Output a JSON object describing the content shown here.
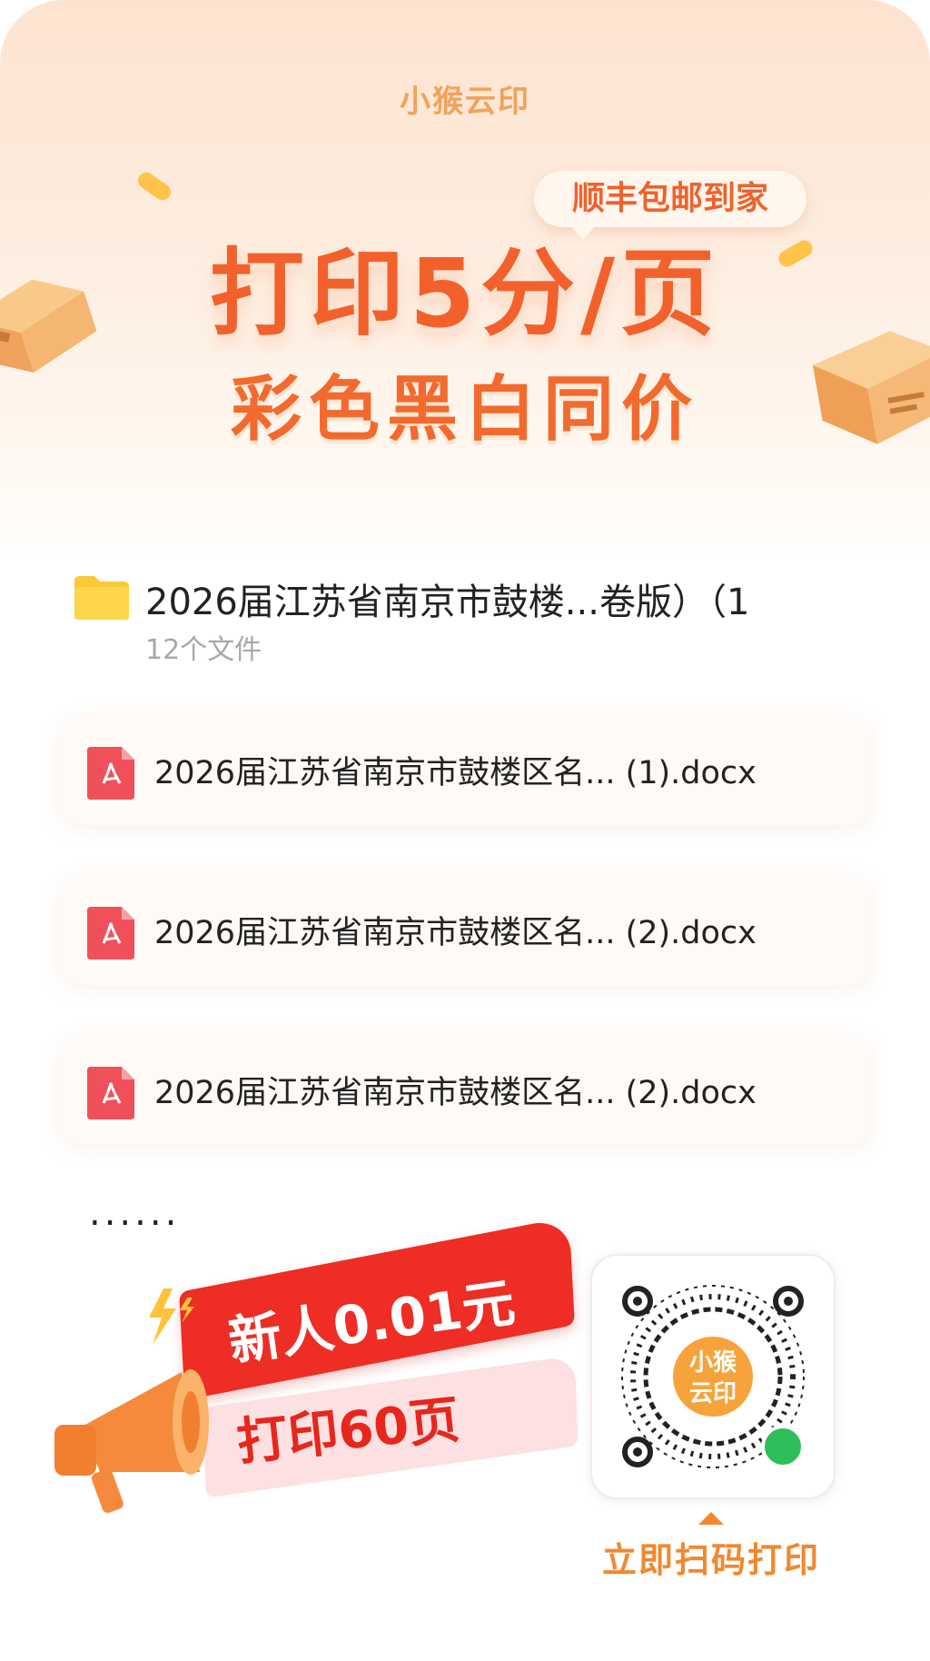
{
  "brand": {
    "name": "小猴云印"
  },
  "banner": {
    "tag": "顺丰包邮到家",
    "headline_line1": "打印5分/页",
    "headline_line2": "彩色黑白同价"
  },
  "folder": {
    "name": "2026届江苏省南京市鼓楼...卷版）（1",
    "count": "12个文件",
    "icon": "folder-icon"
  },
  "files": [
    {
      "name": "2026届江苏省南京市鼓楼区名... (1).docx",
      "icon": "pdf-icon"
    },
    {
      "name": "2026届江苏省南京市鼓楼区名... (2).docx",
      "icon": "pdf-icon"
    },
    {
      "name": "2026届江苏省南京市鼓楼区名... (2).docx",
      "icon": "pdf-icon"
    }
  ],
  "more": "......",
  "promo": {
    "line1": "新人0.01元",
    "line2": "打印60页"
  },
  "qr": {
    "center_text_top": "小猴",
    "center_text_bottom": "云印",
    "caption": "立即扫码打印"
  },
  "colors": {
    "accent": "#f2612c",
    "brand_orange": "#f7a33b",
    "promo_red": "#ee2d24",
    "pdf_red": "#f0505a"
  }
}
